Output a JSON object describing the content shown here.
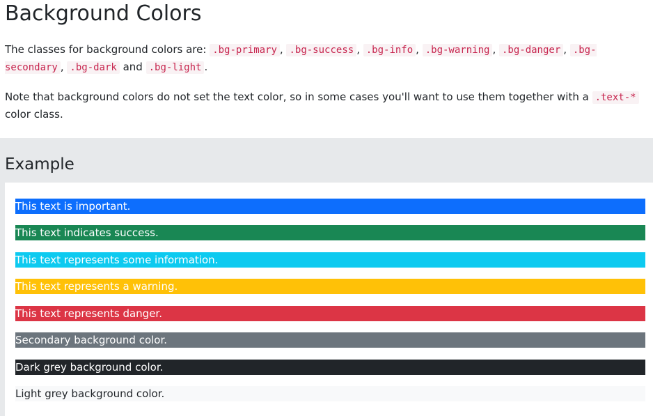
{
  "heading": "Background Colors",
  "intro": {
    "prefix": "The classes for background colors are: ",
    "codes": [
      ".bg-primary",
      ".bg-success",
      ".bg-info",
      ".bg-warning",
      ".bg-danger",
      ".bg-secondary",
      ".bg-dark",
      ".bg-light"
    ],
    "separator": ", ",
    "last_joiner": " and ",
    "suffix": "."
  },
  "note": {
    "prefix": "Note that background colors do not set the text color, so in some cases you'll want to use them together with a ",
    "code": ".text-*",
    "suffix": " color class."
  },
  "example": {
    "title": "Example",
    "bars": [
      {
        "text": "This text is important.",
        "bg": "#0d6efd",
        "color": "#ffffff"
      },
      {
        "text": "This text indicates success.",
        "bg": "#198754",
        "color": "#ffffff"
      },
      {
        "text": "This text represents some information.",
        "bg": "#0dcaf0",
        "color": "#ffffff"
      },
      {
        "text": "This text represents a warning.",
        "bg": "#ffc107",
        "color": "#ffffff"
      },
      {
        "text": "This text represents danger.",
        "bg": "#dc3545",
        "color": "#ffffff"
      },
      {
        "text": "Secondary background color.",
        "bg": "#6c757d",
        "color": "#ffffff"
      },
      {
        "text": "Dark grey background color.",
        "bg": "#212529",
        "color": "#ffffff"
      },
      {
        "text": "Light grey background color.",
        "bg": "#f8f9fa",
        "color": "#212529"
      }
    ]
  }
}
